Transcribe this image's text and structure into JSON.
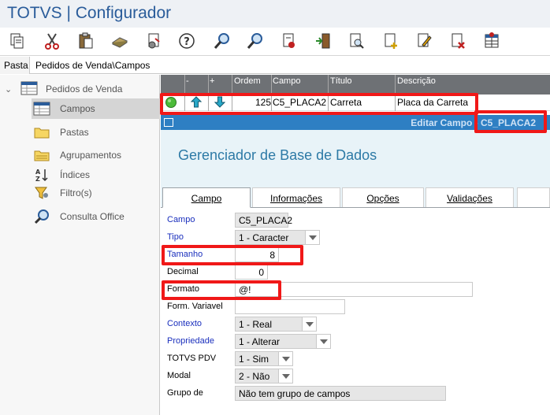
{
  "app": {
    "title": "TOTVS | Configurador"
  },
  "toolbar": {
    "buttons": [
      "copy-icon",
      "cut-icon",
      "paste-icon",
      "database-icon",
      "settings-page-icon",
      "help-icon",
      "search-icon",
      "search-next-icon",
      "document-restore-icon",
      "exit-door-icon",
      "preview-icon",
      "new-document-icon",
      "edit-document-icon",
      "delete-document-icon",
      "grid-icon"
    ]
  },
  "pathbar": {
    "tab": "Pasta",
    "crumb": "Pedidos de Venda\\Campos"
  },
  "sidebar": {
    "root": "Pedidos de Venda",
    "items": [
      {
        "label": "Campos",
        "icon": "table-icon"
      },
      {
        "label": "Pastas",
        "icon": "folder-icon"
      },
      {
        "label": "Agrupamentos",
        "icon": "folder-stack-icon"
      },
      {
        "label": "Índices",
        "icon": "sort-az-icon"
      },
      {
        "label": "Filtro(s)",
        "icon": "funnel-icon"
      },
      {
        "label": "Consulta Office",
        "icon": "magnifier-icon"
      }
    ]
  },
  "grid": {
    "headers": {
      "minus": "-",
      "plus": "+",
      "ordem": "Ordem",
      "campo": "Campo",
      "titulo": "Título",
      "descricao": "Descrição"
    },
    "row": {
      "ordem": "125",
      "campo": "C5_PLACA2",
      "titulo": "Carreta",
      "descricao": "Placa da Carreta"
    }
  },
  "editbar": {
    "title": "Editar Campo - C5_PLACA2"
  },
  "panel": {
    "heading": "Gerenciador de Base de Dados",
    "tabs": [
      "Campo",
      "Informações",
      "Opções",
      "Validações"
    ],
    "form": {
      "campo": {
        "label": "Campo",
        "value": "C5_PLACA2"
      },
      "tipo": {
        "label": "Tipo",
        "value": "1 - Caracter"
      },
      "tamanho": {
        "label": "Tamanho",
        "value": "8"
      },
      "decimal": {
        "label": "Decimal",
        "value": "0"
      },
      "formato": {
        "label": "Formato",
        "value": "@!"
      },
      "form_variavel": {
        "label": "Form. Variavel",
        "value": ""
      },
      "contexto": {
        "label": "Contexto",
        "value": "1 - Real"
      },
      "propriedade": {
        "label": "Propriedade",
        "value": "1 - Alterar"
      },
      "totvs_pdv": {
        "label": "TOTVS PDV",
        "value": "1 - Sim"
      },
      "modal": {
        "label": "Modal",
        "value": "2 - Não"
      },
      "grupo": {
        "label": "Grupo de",
        "value": "Não tem grupo de campos"
      }
    }
  },
  "colors": {
    "highlight": "#f01818",
    "accent": "#2e7fc3",
    "label_blue": "#1a2fbd",
    "heading": "#2d7aa6"
  }
}
